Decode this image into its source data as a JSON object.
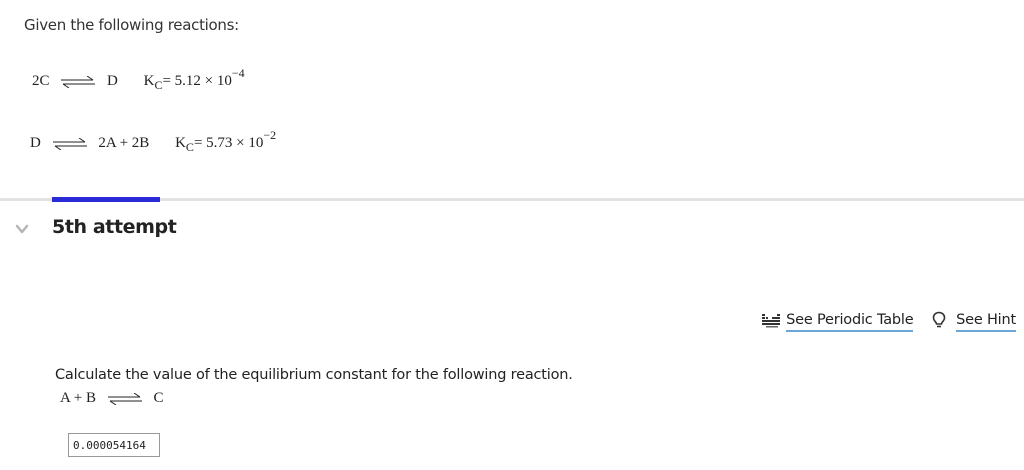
{
  "intro": "Given the following reactions:",
  "reactions": [
    {
      "left": "2C",
      "right": "D",
      "k_label": "K",
      "k_sub": "C",
      "k_value": "= 5.12 × 10",
      "k_exp": "−4"
    },
    {
      "left": "D",
      "right": "2A + 2B",
      "k_label": "K",
      "k_sub": "C",
      "k_value": "= 5.73 × 10",
      "k_exp": "−2"
    }
  ],
  "attempt": {
    "label": "5th attempt"
  },
  "links": {
    "periodic_table": "See Periodic Table",
    "hint": "See Hint"
  },
  "question": {
    "prompt": "Calculate the value of the equilibrium constant for the following reaction.",
    "reaction_left": "A + B",
    "reaction_right": "C"
  },
  "answer": {
    "value": "0.000054164"
  },
  "colors": {
    "accent": "#2a2ad8",
    "link_underline": "#6aa6d8",
    "divider": "#e2e2e2"
  }
}
